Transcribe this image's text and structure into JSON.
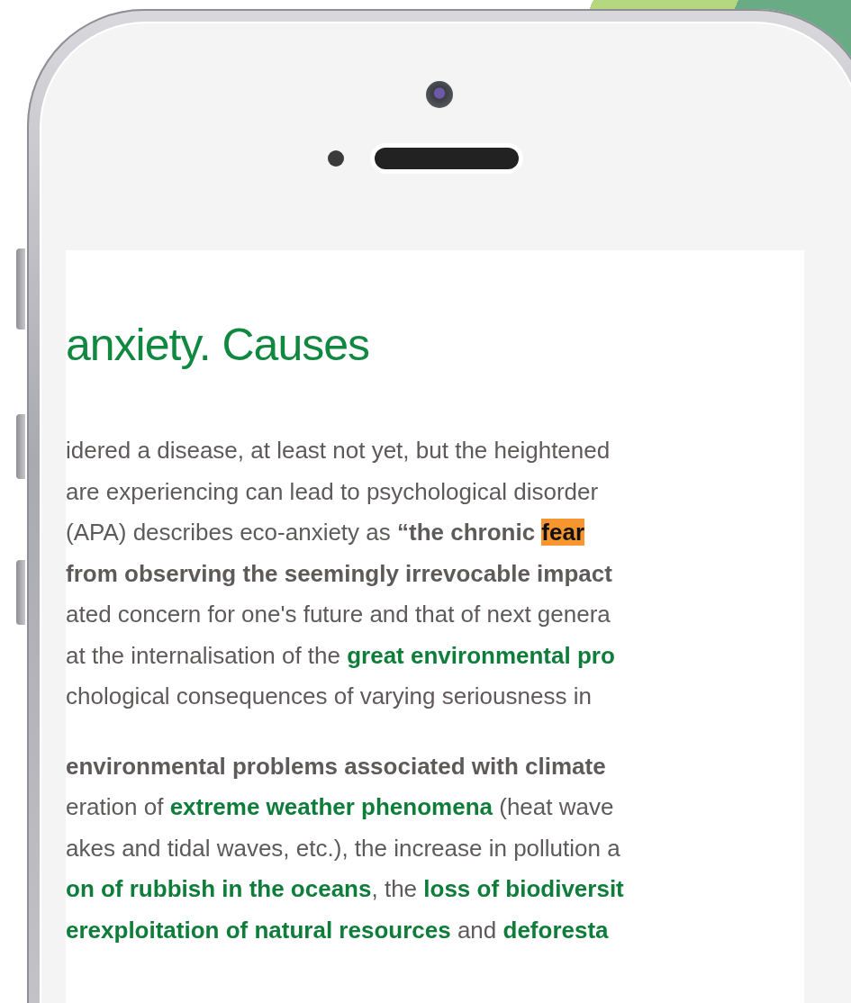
{
  "article": {
    "heading": "anxiety. Causes",
    "paragraphs": [
      {
        "lines": [
          [
            {
              "kind": "plain",
              "text": "idered a disease, at least not yet, but the heightened"
            }
          ],
          [
            {
              "kind": "plain",
              "text": "are experiencing can lead to psychological disorder"
            }
          ],
          [
            {
              "kind": "plain",
              "text": "(APA) describes eco-anxiety as "
            },
            {
              "kind": "bold",
              "text": "“the chronic "
            },
            {
              "kind": "highlight",
              "text": "fear"
            }
          ],
          [
            {
              "kind": "bold",
              "text": "from observing the seemingly irrevocable impact"
            }
          ],
          [
            {
              "kind": "plain",
              "text": "ated concern for one's future and that of next genera"
            }
          ],
          [
            {
              "kind": "plain",
              "text": "at the internalisation of the "
            },
            {
              "kind": "green",
              "text": "great environmental pro"
            }
          ],
          [
            {
              "kind": "plain",
              "text": "chological consequences of varying seriousness in"
            }
          ]
        ]
      },
      {
        "lines": [
          [
            {
              "kind": "bold",
              "text": "environmental problems associated with climate"
            }
          ],
          [
            {
              "kind": "plain",
              "text": "eration of "
            },
            {
              "kind": "green",
              "text": "extreme weather phenomena"
            },
            {
              "kind": "plain",
              "text": " (heat wave"
            }
          ],
          [
            {
              "kind": "plain",
              "text": "akes and tidal waves, etc.), the increase in pollution a"
            }
          ],
          [
            {
              "kind": "green",
              "text": "on of rubbish in the oceans"
            },
            {
              "kind": "plain",
              "text": ", the "
            },
            {
              "kind": "green",
              "text": "loss of biodiversit"
            }
          ],
          [
            {
              "kind": "green",
              "text": "erexploitation of natural resources"
            },
            {
              "kind": "plain",
              "text": " and "
            },
            {
              "kind": "green",
              "text": "deforesta"
            }
          ]
        ]
      }
    ]
  }
}
